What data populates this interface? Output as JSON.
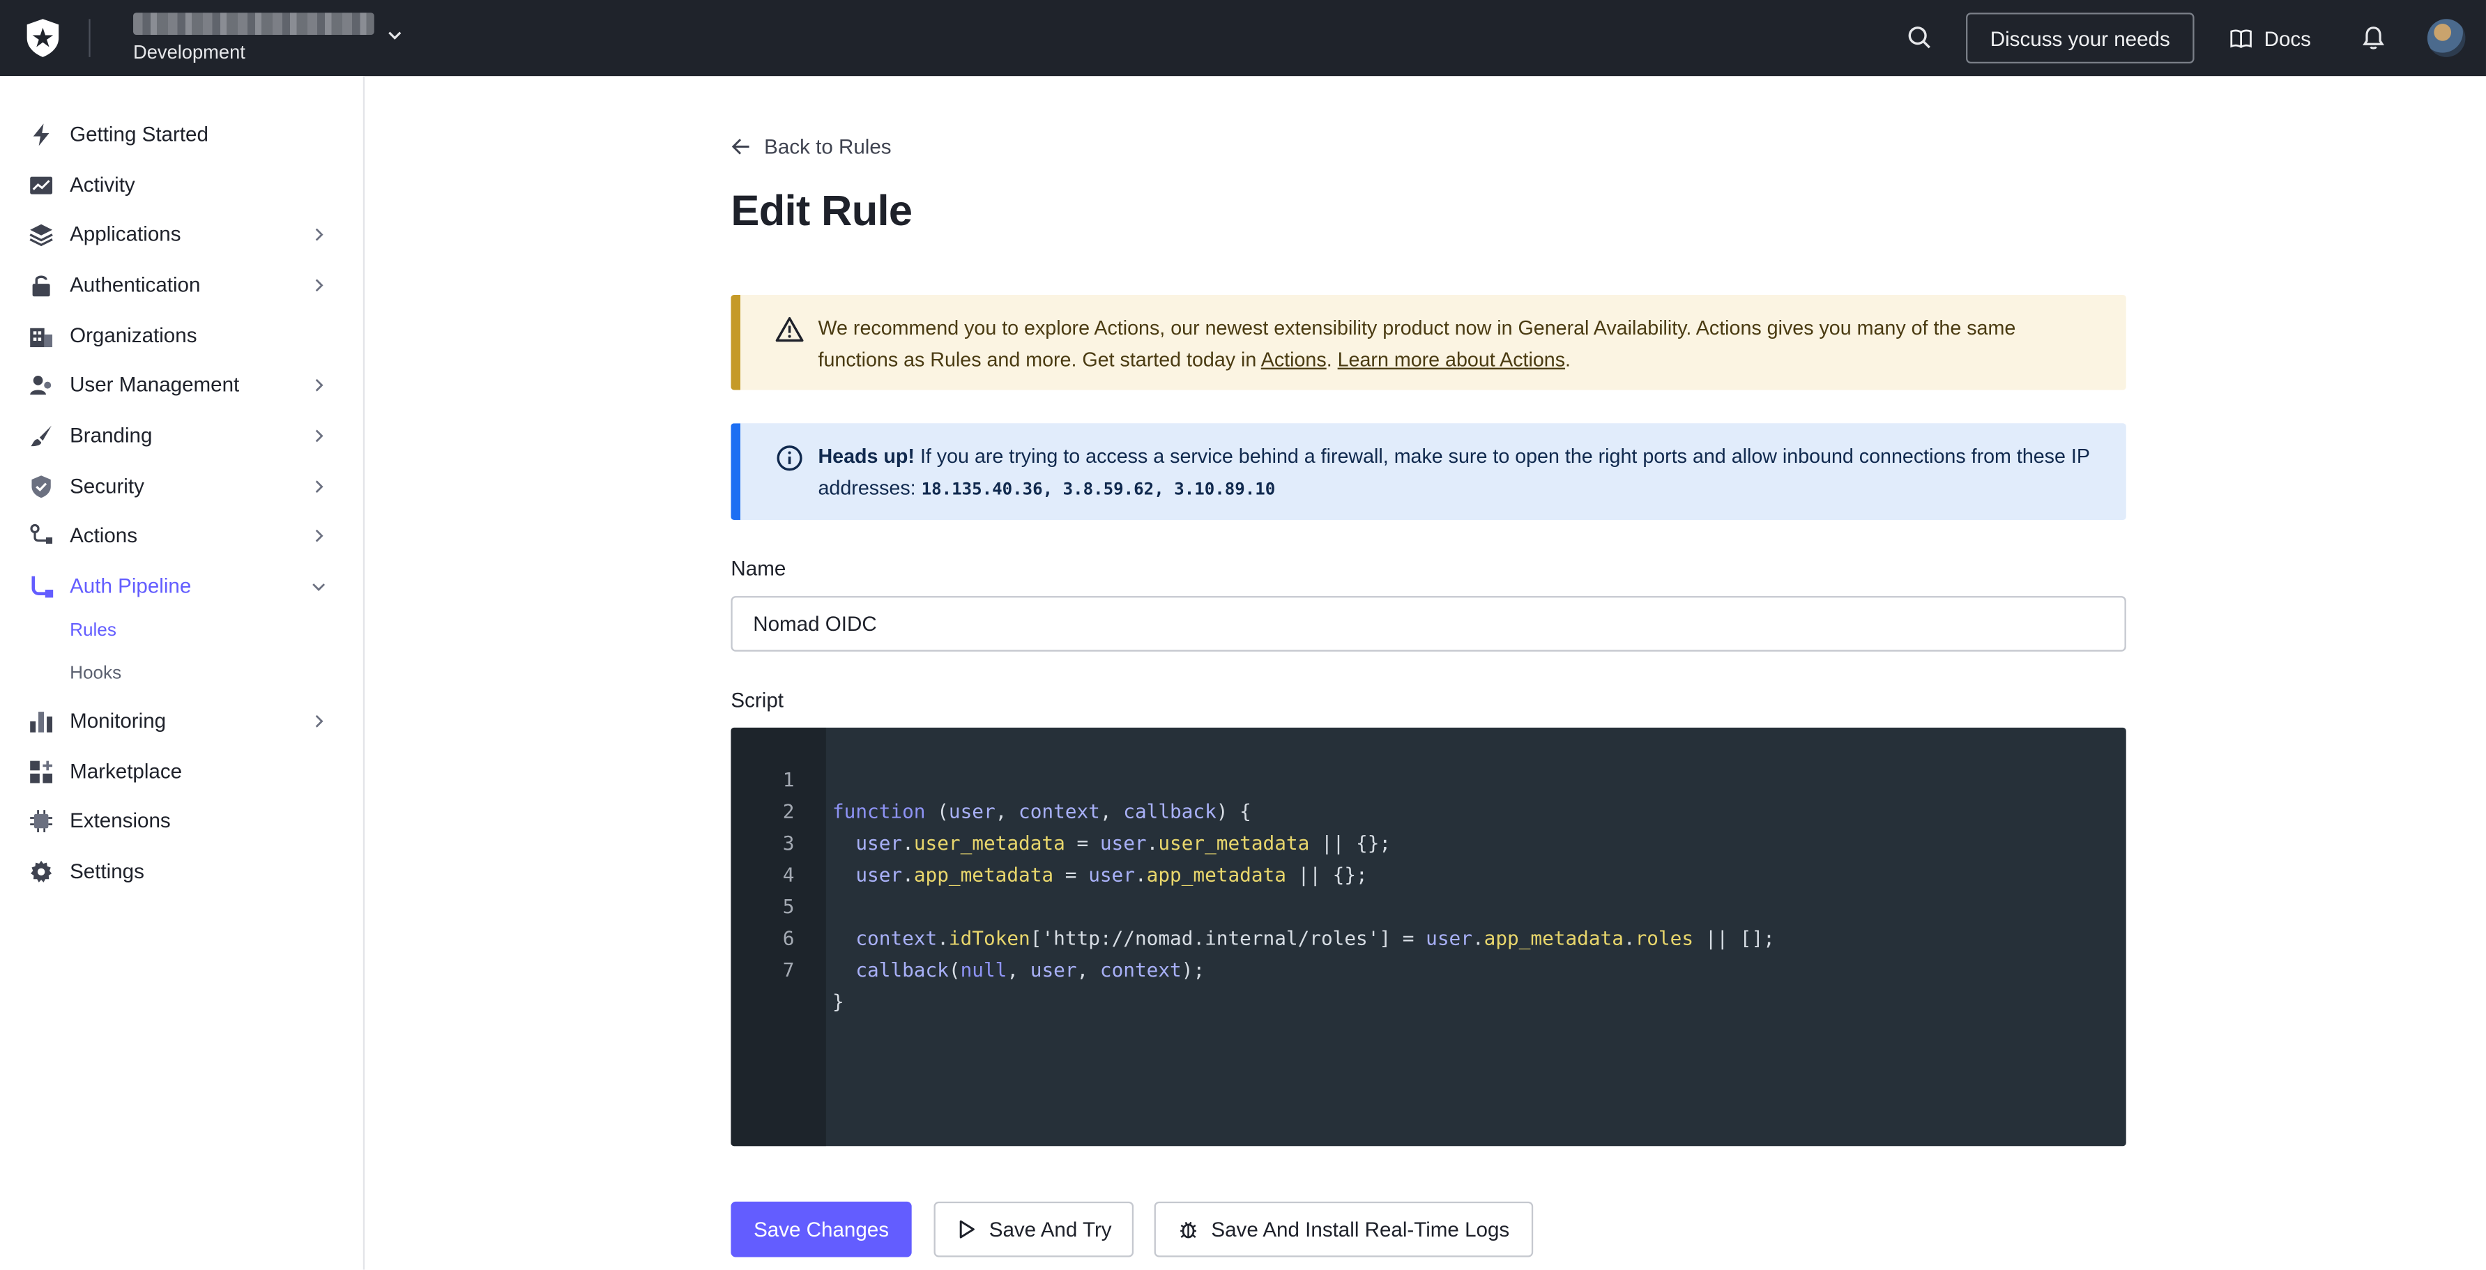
{
  "topbar": {
    "tenant_env": "Development",
    "discuss_label": "Discuss your needs",
    "docs_label": "Docs"
  },
  "sidebar": {
    "items": [
      {
        "label": "Getting Started",
        "icon": "bolt-icon"
      },
      {
        "label": "Activity",
        "icon": "activity-icon"
      },
      {
        "label": "Applications",
        "icon": "layers-icon"
      },
      {
        "label": "Authentication",
        "icon": "lock-icon"
      },
      {
        "label": "Organizations",
        "icon": "building-icon"
      },
      {
        "label": "User Management",
        "icon": "users-icon"
      },
      {
        "label": "Branding",
        "icon": "brush-icon"
      },
      {
        "label": "Security",
        "icon": "shield-icon"
      },
      {
        "label": "Actions",
        "icon": "flow-icon"
      },
      {
        "label": "Auth Pipeline",
        "icon": "pipeline-icon"
      },
      {
        "label": "Monitoring",
        "icon": "bar-chart-icon"
      },
      {
        "label": "Marketplace",
        "icon": "grid-plus-icon"
      },
      {
        "label": "Extensions",
        "icon": "chip-icon"
      },
      {
        "label": "Settings",
        "icon": "gear-icon"
      }
    ],
    "sub_items": [
      "Rules",
      "Hooks"
    ],
    "active_color": "#635dff"
  },
  "main": {
    "back_label": "Back to Rules",
    "title": "Edit Rule",
    "warning": {
      "text_1": "We recommend you to explore Actions, our newest extensibility product now in General Availability. Actions gives you many of the same functions as Rules and more. Get started today in ",
      "link_1": "Actions",
      "text_2": ". ",
      "link_2": "Learn more about Actions",
      "text_3": "."
    },
    "info": {
      "bold": "Heads up!",
      "text": " If you are trying to access a service behind a firewall, make sure to open the right ports and allow inbound connections from these IP addresses: ",
      "ips": "18.135.40.36, 3.8.59.62, 3.10.89.10"
    },
    "name_label": "Name",
    "name_value": "Nomad OIDC",
    "script_label": "Script",
    "code_lines": [
      "function (user, context, callback) {",
      "  user.user_metadata = user.user_metadata || {};",
      "  user.app_metadata = user.app_metadata || {};",
      "",
      "  context.idToken['http://nomad.internal/roles'] = user.app_metadata.roles || [];",
      "  callback(null, user, context);",
      "}"
    ],
    "line_numbers": [
      "1",
      "2",
      "3",
      "4",
      "5",
      "6",
      "7"
    ],
    "buttons": {
      "save": "Save Changes",
      "try": "Save And Try",
      "logs": "Save And Install Real-Time Logs"
    }
  }
}
